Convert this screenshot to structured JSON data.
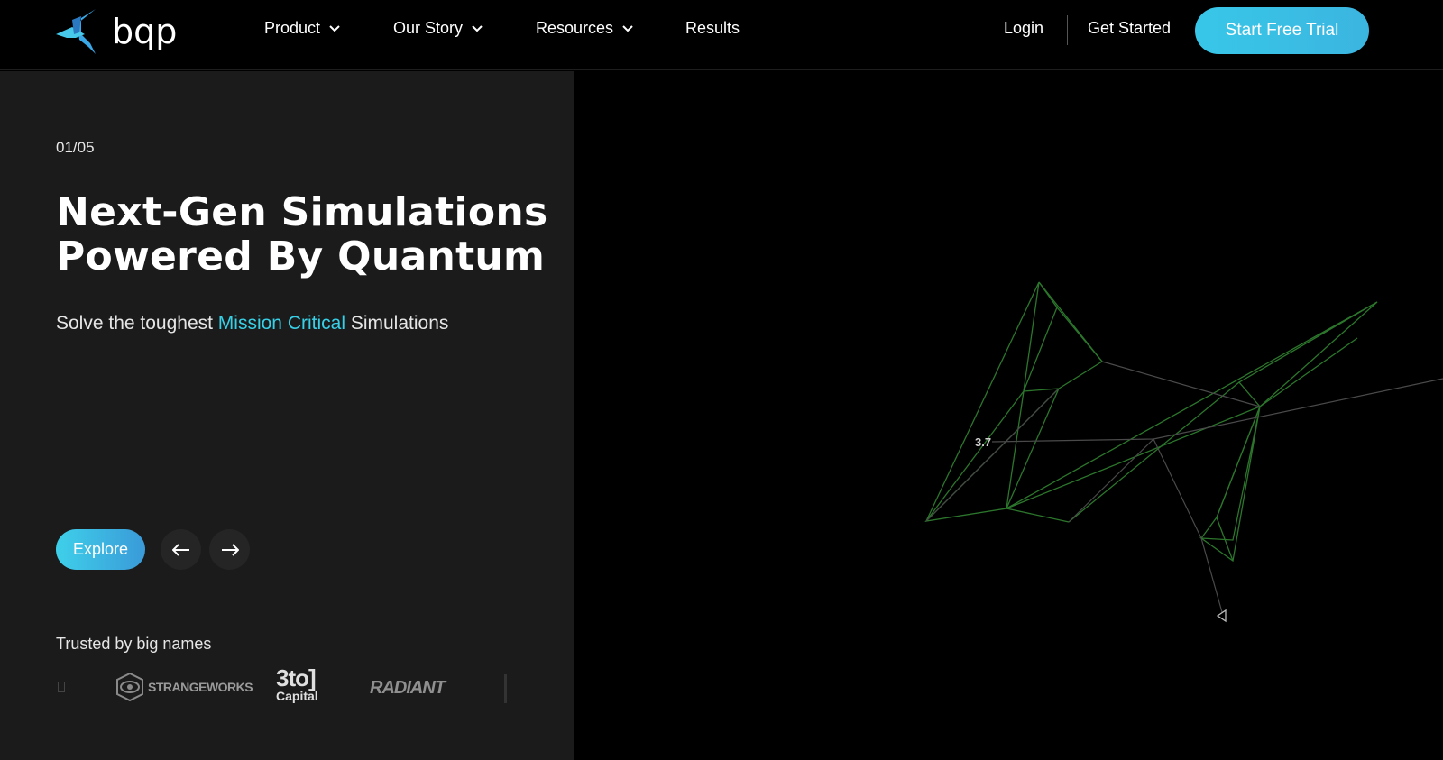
{
  "nav": {
    "logo_text": "bqp",
    "items": [
      {
        "label": "Product",
        "has_dropdown": true
      },
      {
        "label": "Our Story",
        "has_dropdown": true
      },
      {
        "label": "Resources",
        "has_dropdown": true
      },
      {
        "label": "Results",
        "has_dropdown": false
      }
    ],
    "login_label": "Login",
    "get_started_label": "Get Started",
    "trial_label": "Start Free Trial"
  },
  "hero": {
    "counter": "01/05",
    "headline_line1": "Next-Gen Simulations",
    "headline_line2": "Powered By Quantum",
    "sub_prefix": "Solve the toughest ",
    "sub_highlight": "Mission Critical",
    "sub_suffix": " Simulations",
    "explore_label": "Explore",
    "trusted_label": "Trusted by big names",
    "partner_logos": [
      "STRANGEWORKS",
      "3to1 Capital",
      "RADIANT"
    ]
  },
  "visual": {
    "label": "3.7"
  },
  "colors": {
    "accent": "#37d0e6",
    "panel": "#1b1b1c",
    "mesh_green": "#2f8a2f"
  },
  "icons": [
    "chevron-down-icon",
    "arrow-left-icon",
    "arrow-right-icon",
    "eye-icon"
  ]
}
